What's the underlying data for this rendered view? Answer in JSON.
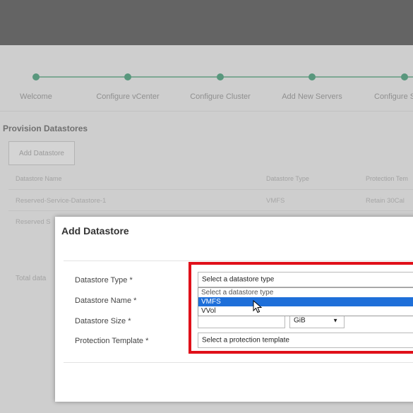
{
  "wizard": {
    "steps": [
      {
        "label": "Welcome"
      },
      {
        "label": "Configure vCenter"
      },
      {
        "label": "Configure Cluster"
      },
      {
        "label": "Add New Servers"
      },
      {
        "label": "Configure S"
      }
    ]
  },
  "provision": {
    "title": "Provision Datastores",
    "add_button": "Add Datastore",
    "columns": {
      "name": "Datastore Name",
      "type": "Datastore Type",
      "protection": "Protection Tem"
    },
    "rows": [
      {
        "name": "Reserved-Service-Datastore-1",
        "type": "VMFS",
        "protection": "Retain 30Cal"
      },
      {
        "name": "Reserved S"
      }
    ],
    "total_label": "Total data"
  },
  "modal": {
    "title": "Add Datastore",
    "fields": {
      "type_label": "Datastore Type *",
      "name_label": "Datastore Name *",
      "size_label": "Datastore Size *",
      "protection_label": "Protection Template *"
    },
    "type_select": {
      "value": "Select a datastore type",
      "options": [
        "Select a datastore type",
        "VMFS",
        "VVol"
      ],
      "highlighted": "VMFS"
    },
    "size_unit": "GiB",
    "protection_select": {
      "value": "Select a protection template"
    }
  },
  "colors": {
    "highlight_box": "#e0101a",
    "selected_option": "#1e6fd9",
    "wizard_accent": "#4aa57f"
  }
}
